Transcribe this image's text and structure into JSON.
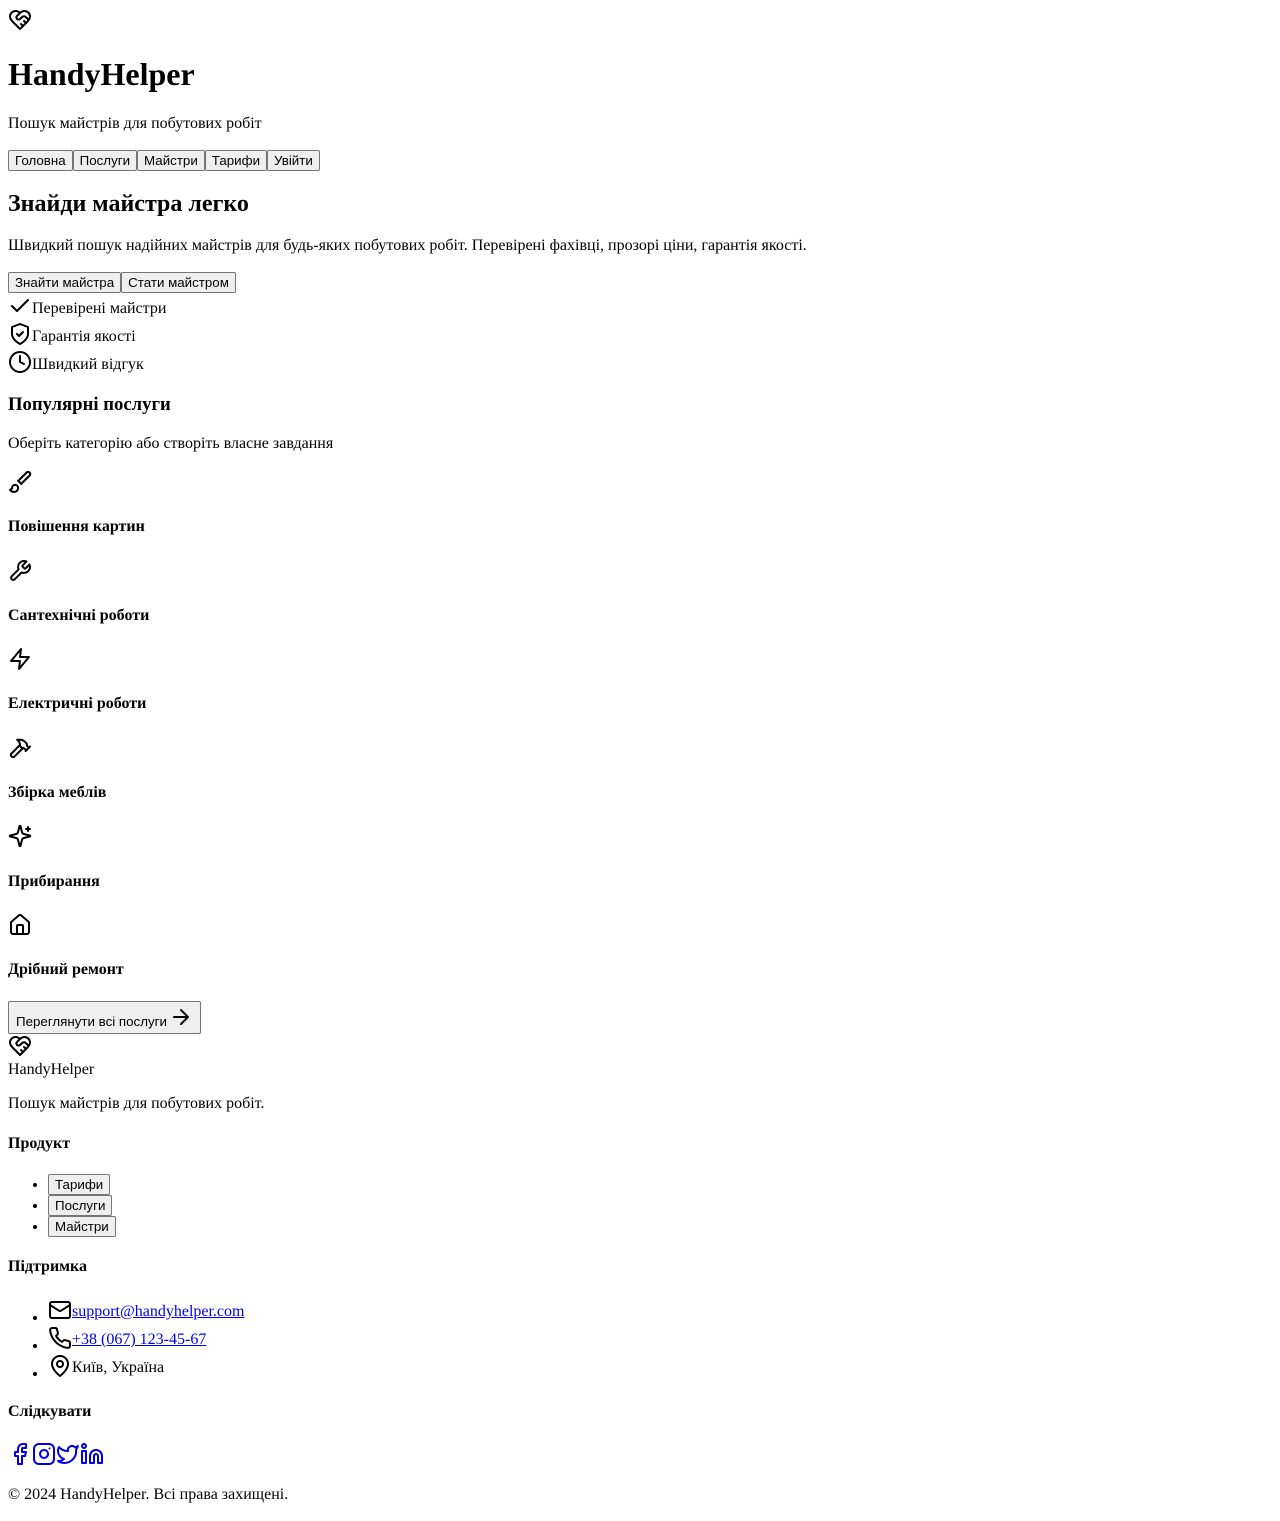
{
  "header": {
    "logo_icon": "handshake-heart-icon",
    "title": "HandyHelper",
    "tagline": "Пошук майстрів для побутових робіт"
  },
  "nav": {
    "items": [
      "Головна",
      "Послуги",
      "Майстри",
      "Тарифи",
      "Увійти"
    ]
  },
  "hero": {
    "title": "Знайди майстра легко",
    "text": "Швидкий пошук надійних майстрів для будь-яких побутових робіт. Перевірені фахівці, прозорі ціни, гарантія якості.",
    "primary_button": "Знайти майстра",
    "secondary_button": "Стати майстром",
    "features": [
      {
        "icon": "check-icon",
        "label": "Перевірені майстри"
      },
      {
        "icon": "shield-check-icon",
        "label": "Гарантія якості"
      },
      {
        "icon": "clock-icon",
        "label": "Швидкий відгук"
      }
    ]
  },
  "services": {
    "title": "Популярні послуги",
    "subtitle": "Оберіть категорію або створіть власне завдання",
    "items": [
      {
        "icon": "paintbrush-icon",
        "title": "Повішення картин"
      },
      {
        "icon": "wrench-icon",
        "title": "Сантехнічні роботи"
      },
      {
        "icon": "lightning-icon",
        "title": "Електричні роботи"
      },
      {
        "icon": "hammer-icon",
        "title": "Збірка меблів"
      },
      {
        "icon": "sparkles-icon",
        "title": "Прибирання"
      },
      {
        "icon": "home-icon",
        "title": "Дрібний ремонт"
      }
    ],
    "view_all": "Переглянути всі послуги"
  },
  "footer": {
    "name": "HandyHelper",
    "description": "Пошук майстрів для побутових робіт.",
    "product": {
      "title": "Продукт",
      "links": [
        "Тарифи",
        "Послуги",
        "Майстри"
      ]
    },
    "support": {
      "title": "Підтримка",
      "email": "support@handyhelper.com",
      "phone": "+38 (067) 123-45-67",
      "address": "Київ, Україна"
    },
    "follow": {
      "title": "Слідкувати",
      "networks": [
        "facebook-icon",
        "instagram-icon",
        "twitter-icon",
        "linkedin-icon"
      ]
    },
    "copyright": "© 2024 HandyHelper. Всі права захищені."
  }
}
